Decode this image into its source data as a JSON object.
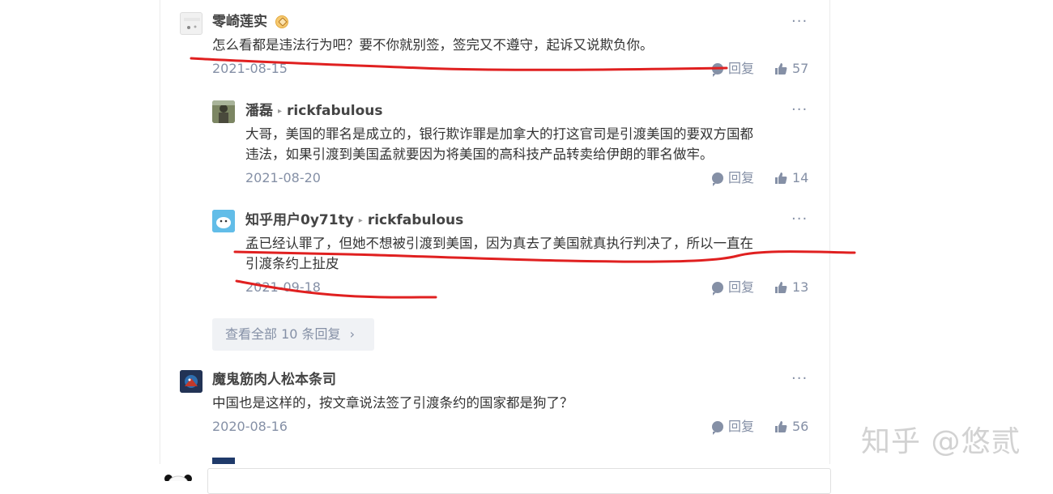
{
  "comments": [
    {
      "author": "零崎莲实",
      "content_lines": [
        "怎么看都是违法行为吧？要不你就别签，签完又不遵守，起诉又说欺负你。"
      ],
      "date": "2021-08-15",
      "reply_label": "回复",
      "likes": "57",
      "avatar_icon": "user-avatar-icon",
      "more": "···"
    },
    {
      "author": "潘磊",
      "reply_to": "rickfabulous",
      "content_lines": [
        "大哥，美国的罪名是成立的，银行欺诈罪是加拿大的打这官司是引渡美国的要双方国都",
        "违法，如果引渡到美国孟就要因为将美国的高科技产品转卖给伊朗的罪名做牢。"
      ],
      "date": "2021-08-20",
      "reply_label": "回复",
      "likes": "14",
      "more": "···"
    },
    {
      "author": "知乎用户0y71ty",
      "reply_to": "rickfabulous",
      "content_lines": [
        "孟已经认罪了，但她不想被引渡到美国，因为真去了美国就真执行判决了，所以一直在",
        "引渡条约上扯皮"
      ],
      "date": "2021-09-18",
      "reply_label": "回复",
      "likes": "13",
      "more": "···"
    },
    {
      "author": "魔鬼筋肉人松本条司",
      "content_lines": [
        "中国也是这样的，按文章说法签了引渡条约的国家都是狗了？"
      ],
      "date": "2020-08-16",
      "reply_label": "回复",
      "likes": "56",
      "more": "···"
    }
  ],
  "view_all_label": "查看全部 10 条回复",
  "watermark": "知乎 @悠贰",
  "colors": {
    "annotation": "#e02020",
    "meta": "#8590a6"
  }
}
